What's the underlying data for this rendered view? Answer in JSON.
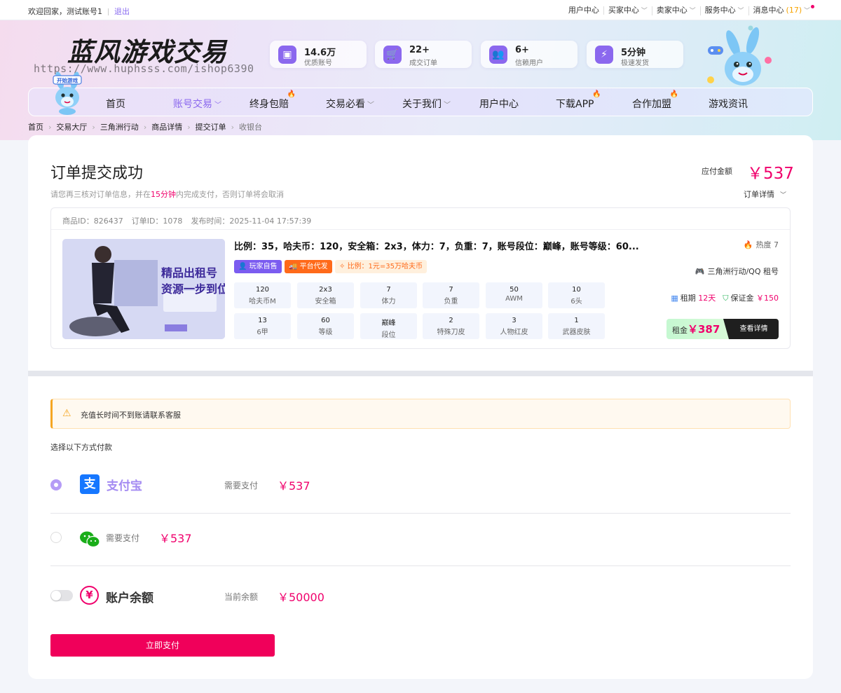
{
  "topbar": {
    "welcome": "欢迎回家，测试账号1",
    "logout": "退出",
    "menu": [
      "用户中心",
      "买家中心",
      "卖家中心",
      "服务中心",
      "消息中心"
    ],
    "message_count": "(17)"
  },
  "brand": {
    "logo_text": "蓝风游戏交易",
    "watermark": "https://www.huphsss.com/ishop6390",
    "mascot_sign": "开始游戏"
  },
  "stats": [
    {
      "value": "14.6万",
      "desc": "优质账号",
      "icon": "cube-icon"
    },
    {
      "value": "22+",
      "desc": "成交订单",
      "icon": "cart-icon"
    },
    {
      "value": "6+",
      "desc": "信赖用户",
      "icon": "users-icon"
    },
    {
      "value": "5分钟",
      "desc": "极速发货",
      "icon": "lightning-icon"
    }
  ],
  "nav": [
    "首页",
    "账号交易",
    "终身包赔",
    "交易必看",
    "关于我们",
    "用户中心",
    "下载APP",
    "合作加盟",
    "游戏资讯"
  ],
  "breadcrumb": [
    "首页",
    "交易大厅",
    "三角洲行动",
    "商品详情",
    "提交订单",
    "收银台"
  ],
  "order": {
    "title": "订单提交成功",
    "tip_prefix": "请您再三核对订单信息，并在",
    "tip_time": "15分钟",
    "tip_suffix": "内完成支付，否则订单将会取消",
    "pay_label": "应付金额",
    "pay_amount": "￥537",
    "details_toggle": "订单详情",
    "product_id": "商品ID：826437",
    "order_id": "订单ID：1078",
    "publish_time": "发布时间：2025-11-04 17:57:39"
  },
  "product": {
    "title": "比例：35，哈夫币：120，安全箱：2x3，体力：7，负重：7，账号段位：巅峰，账号等级：60...",
    "thumb_text1": "精品出租号",
    "thumb_text2": "资源一步到位",
    "tags": [
      "玩家自售",
      "平台代发",
      "比例：1元=35万哈夫币"
    ],
    "attrs": [
      {
        "v": "120",
        "l": "哈夫币M"
      },
      {
        "v": "2x3",
        "l": "安全箱"
      },
      {
        "v": "7",
        "l": "体力"
      },
      {
        "v": "7",
        "l": "负重"
      },
      {
        "v": "50",
        "l": "AWM"
      },
      {
        "v": "10",
        "l": "6头"
      },
      {
        "v": "13",
        "l": "6甲"
      },
      {
        "v": "60",
        "l": "等级"
      },
      {
        "v": "巅峰",
        "l": "段位"
      },
      {
        "v": "2",
        "l": "特殊刀皮"
      },
      {
        "v": "3",
        "l": "人物红皮"
      },
      {
        "v": "1",
        "l": "武器皮肤"
      }
    ],
    "heat": "热度 7",
    "game": "三角洲行动/QQ 租号",
    "rent_label": "租期",
    "rent_period": "12天",
    "deposit_label": "保证金",
    "deposit": "￥150",
    "rent_fee_label": "租金",
    "rent_fee": "￥387",
    "view_btn": "查看详情"
  },
  "payment": {
    "warning": "充值长时间不到账请联系客服",
    "choose_label": "选择以下方式付款",
    "alipay": {
      "name": "支付宝",
      "label": "需要支付",
      "amount": "￥537"
    },
    "wechat": {
      "label": "需要支付",
      "amount": "￥537"
    },
    "balance": {
      "name": "账户余额",
      "label": "当前余额",
      "amount": "￥50000"
    },
    "pay_button": "立即支付"
  },
  "colors": {
    "accent": "#8b68ee",
    "price": "#f0006c",
    "pay_button": "#f0005a"
  }
}
